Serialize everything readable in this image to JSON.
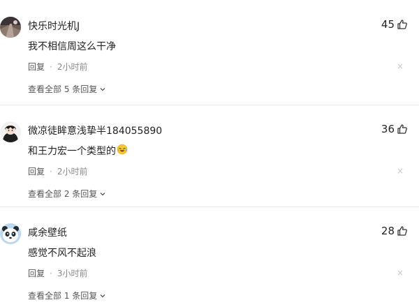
{
  "comments": [
    {
      "username": "快乐时光机J",
      "text": "我不相信周这么干净",
      "likes": "45",
      "reply_label": "回复",
      "separator": "·",
      "time": "2小时前",
      "view_replies": "查看全部 5 条回复",
      "avatar_icon": "photo-avatar",
      "close_icon": "×"
    },
    {
      "username": "微凉徒眸意浅挚半184055890",
      "text": "和王力宏一个类型的",
      "likes": "36",
      "reply_label": "回复",
      "separator": "·",
      "time": "2小时前",
      "view_replies": "查看全部 2 条回复",
      "avatar_icon": "anime-avatar",
      "emoji": "laughing-crying-emoji",
      "close_icon": "×"
    },
    {
      "username": "咸余壁纸",
      "text": "感觉不风不起浪",
      "likes": "28",
      "reply_label": "回复",
      "separator": "·",
      "time": "3小时前",
      "view_replies": "查看全部 1 条回复",
      "avatar_icon": "panda-avatar",
      "close_icon": "×"
    }
  ],
  "colors": {
    "text": "#222222",
    "meta": "#555555",
    "time": "#888888",
    "close": "#c8c8c8",
    "divider": "#e6e6e6"
  }
}
